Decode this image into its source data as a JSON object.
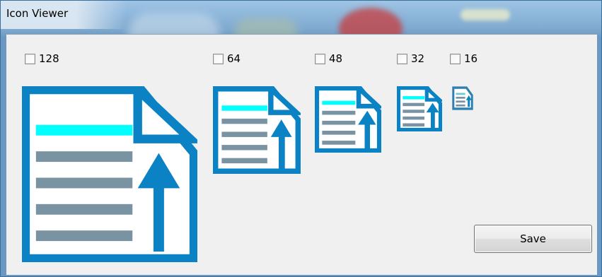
{
  "window": {
    "title": "Icon Viewer"
  },
  "sizes": [
    {
      "label": "128",
      "checked": false
    },
    {
      "label": "64",
      "checked": false
    },
    {
      "label": "48",
      "checked": false
    },
    {
      "label": "32",
      "checked": false
    },
    {
      "label": "16",
      "checked": false
    }
  ],
  "icon": {
    "name": "document-upload-icon",
    "colors": {
      "frame": "#0a82c3",
      "highlight_line": "#00ffff",
      "text_lines": "#7a93a3",
      "paper": "#ffffff"
    }
  },
  "save_button": {
    "label": "Save"
  }
}
